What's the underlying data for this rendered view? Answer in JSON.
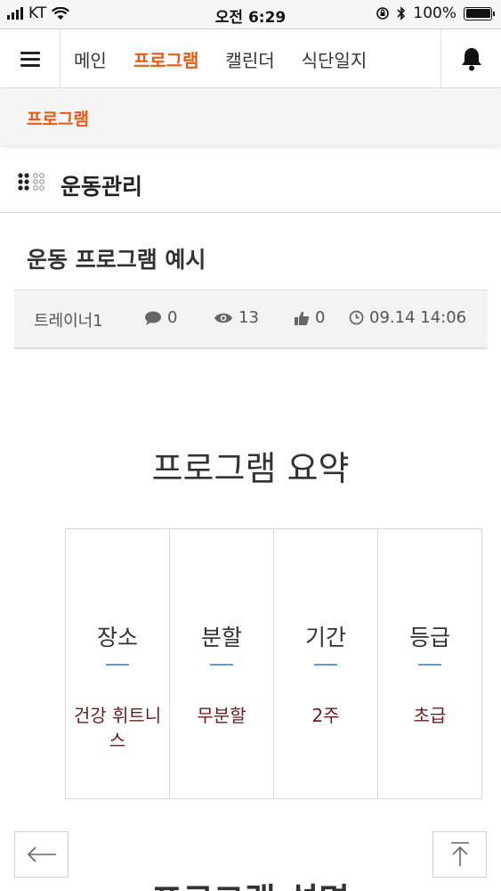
{
  "status_bar": {
    "carrier": "KT",
    "time": "오전 6:29",
    "battery": "100%",
    "battery_level": 1.0
  },
  "nav": {
    "items": [
      {
        "label": "메인",
        "active": false
      },
      {
        "label": "프로그램",
        "active": true
      },
      {
        "label": "캘린더",
        "active": false
      },
      {
        "label": "식단일지",
        "active": false
      }
    ]
  },
  "breadcrumb": {
    "label": "프로그램"
  },
  "board": {
    "title": "운동관리"
  },
  "post": {
    "title": "운동 프로그램 예시",
    "author": "트레이너1",
    "comments": "0",
    "views": "13",
    "likes": "0",
    "datetime": "09.14 14:06"
  },
  "summary": {
    "title": "프로그램 요약",
    "items": [
      {
        "label": "장소",
        "value": "건강 휘트니스"
      },
      {
        "label": "분할",
        "value": "무분할"
      },
      {
        "label": "기간",
        "value": "2주"
      },
      {
        "label": "등급",
        "value": "초급"
      }
    ]
  },
  "next_section": {
    "title": "프로그램 설명"
  },
  "colors": {
    "accent": "#e85a13",
    "value_text": "#6b1c1c",
    "divider_line": "#5aa0d8"
  },
  "icons": [
    "hamburger-menu-icon",
    "bell-icon",
    "comment-icon",
    "eye-icon",
    "thumbs-up-icon",
    "clock-icon",
    "arrow-left-icon",
    "arrow-up-to-top-icon"
  ]
}
